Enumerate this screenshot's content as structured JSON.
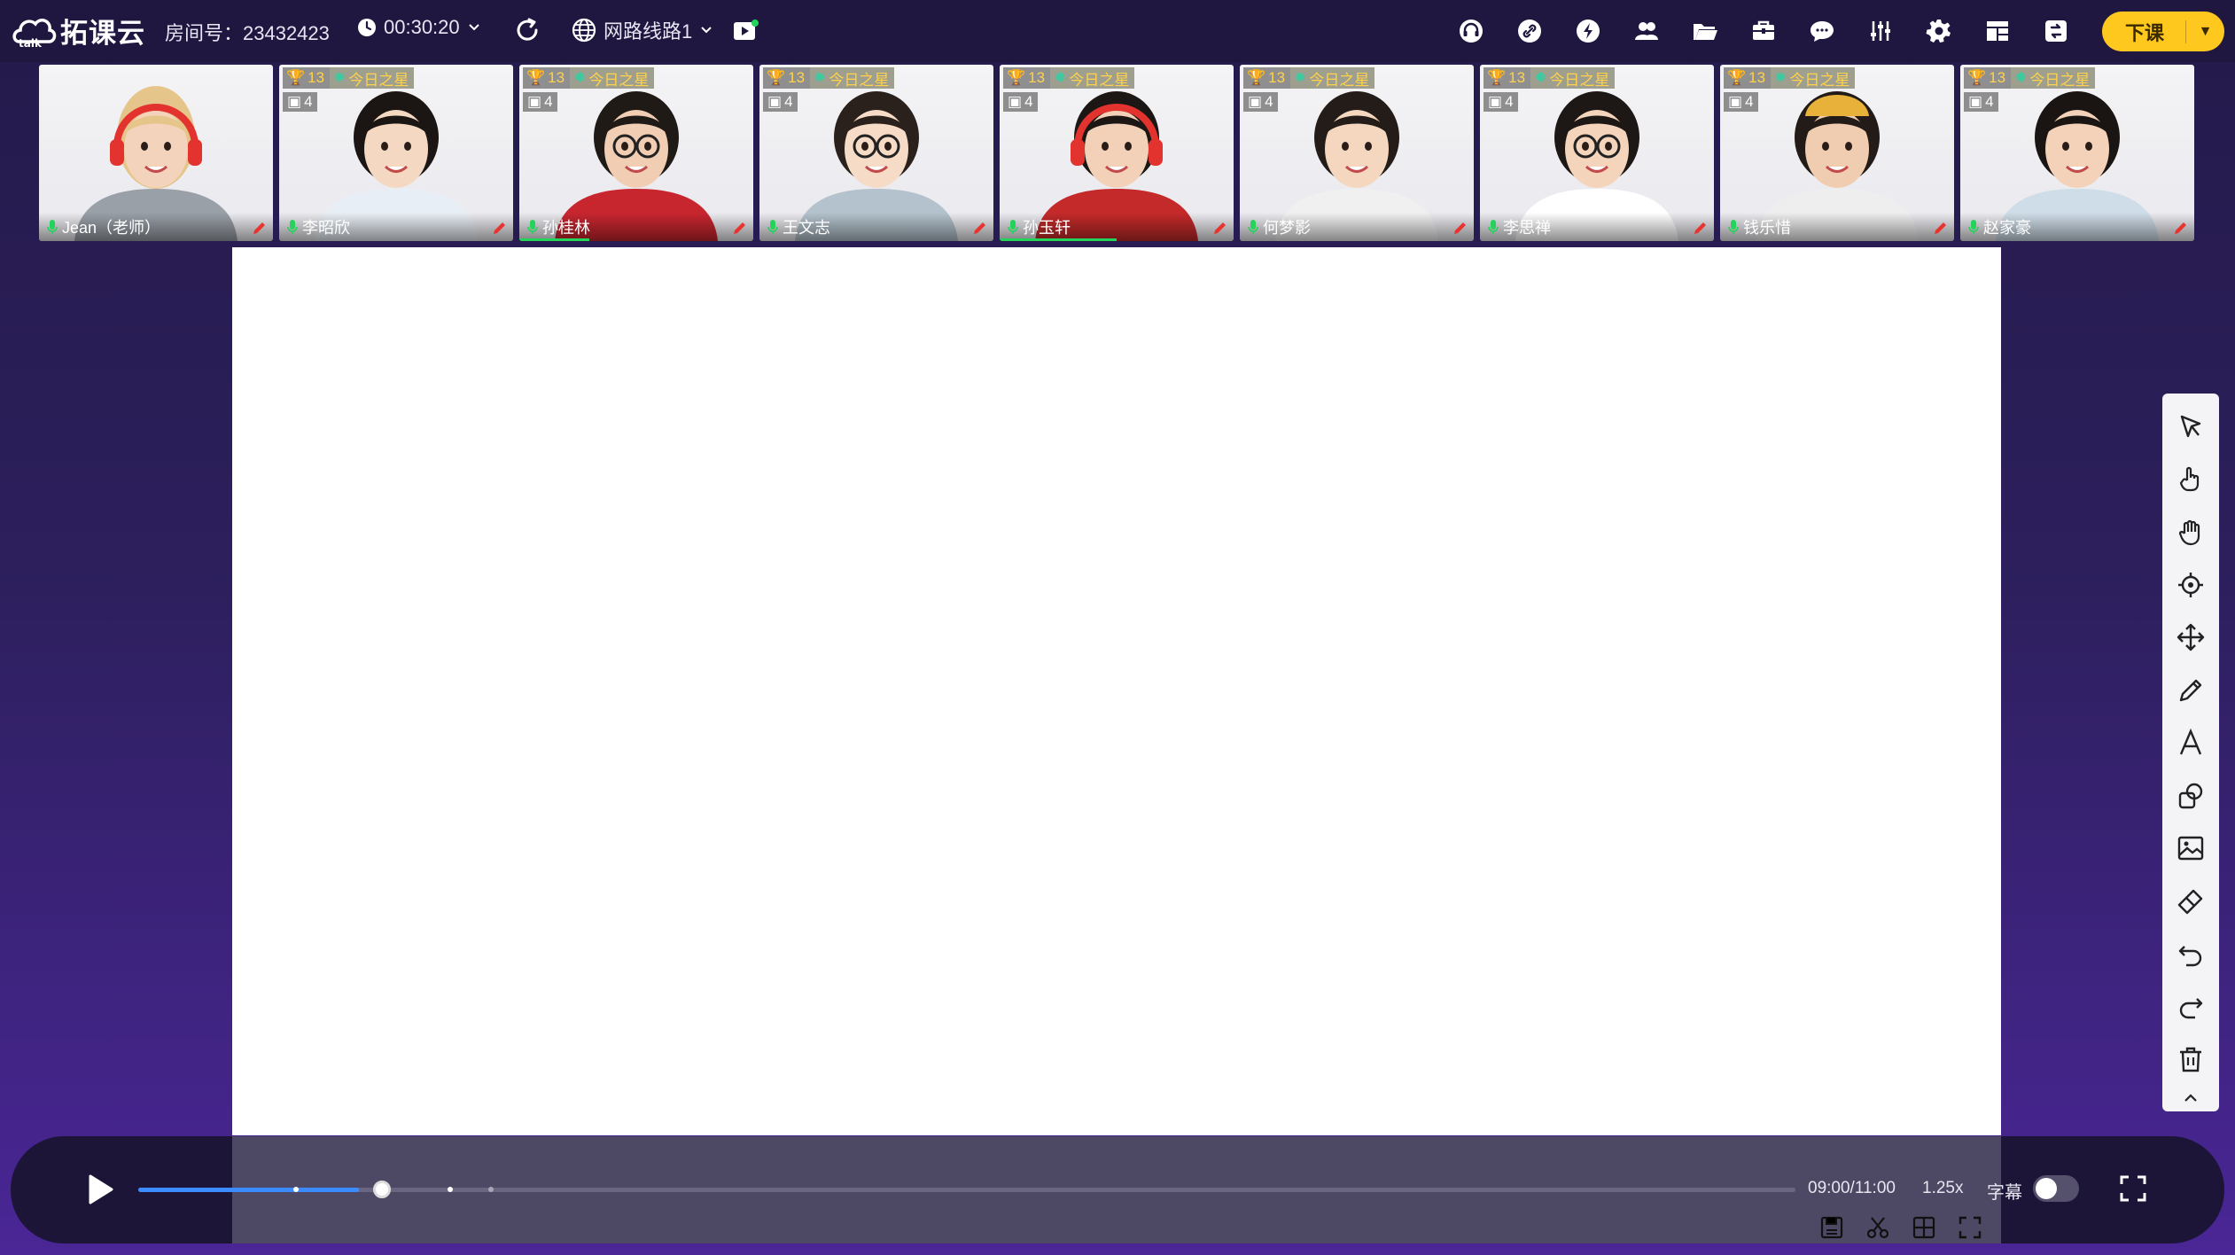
{
  "app": {
    "logo_text": "拓课云",
    "room_label": "房间号：23432423",
    "timer": "00:30:20",
    "network": "网路线路1",
    "end_class": "下课"
  },
  "toolbar_icons": [
    "headset-icon",
    "link-icon",
    "lightning-icon",
    "users-icon",
    "folder-icon",
    "toolbox-icon",
    "chat-icon",
    "mixer-icon",
    "settings-icon",
    "layout-icon",
    "screen-icon"
  ],
  "participants": [
    {
      "name": "Jean（老师）",
      "is_teacher": true,
      "audio_level": 0.0
    },
    {
      "name": "李昭欣",
      "trophies": "13",
      "star_label": "今日之星",
      "cups": "4",
      "audio_level": 0.0
    },
    {
      "name": "孙桂林",
      "trophies": "13",
      "star_label": "今日之星",
      "cups": "4",
      "audio_level": 0.3
    },
    {
      "name": "王文志",
      "trophies": "13",
      "star_label": "今日之星",
      "cups": "4",
      "audio_level": 0.0
    },
    {
      "name": "孙玉轩",
      "trophies": "13",
      "star_label": "今日之星",
      "cups": "4",
      "audio_level": 0.5
    },
    {
      "name": "何梦影",
      "trophies": "13",
      "star_label": "今日之星",
      "cups": "4",
      "audio_level": 0.0
    },
    {
      "name": "李思禅",
      "trophies": "13",
      "star_label": "今日之星",
      "cups": "4",
      "audio_level": 0.0
    },
    {
      "name": "钱乐惜",
      "trophies": "13",
      "star_label": "今日之星",
      "cups": "4",
      "audio_level": 0.0
    },
    {
      "name": "赵家豪",
      "trophies": "13",
      "star_label": "今日之星",
      "cups": "4",
      "audio_level": 0.0
    }
  ],
  "tools": [
    "select-icon",
    "click-icon",
    "hand-icon",
    "laser-icon",
    "move-icon",
    "pen-icon",
    "text-icon",
    "shape-icon",
    "image-icon",
    "eraser-icon",
    "undo-icon",
    "redo-icon",
    "trash-icon",
    "collapse-icon"
  ],
  "player": {
    "time": "09:00/11:00",
    "speed": "1.25x",
    "subtitle_label": "字幕",
    "subtitle_on": false,
    "progress": 0.147,
    "buffered": 0.133,
    "markers": [
      0.095,
      0.188,
      0.213
    ]
  },
  "colors": {
    "accent_yellow": "#ffc81e",
    "progress_blue": "#3d8cff",
    "audio_green": "#23d35a"
  }
}
